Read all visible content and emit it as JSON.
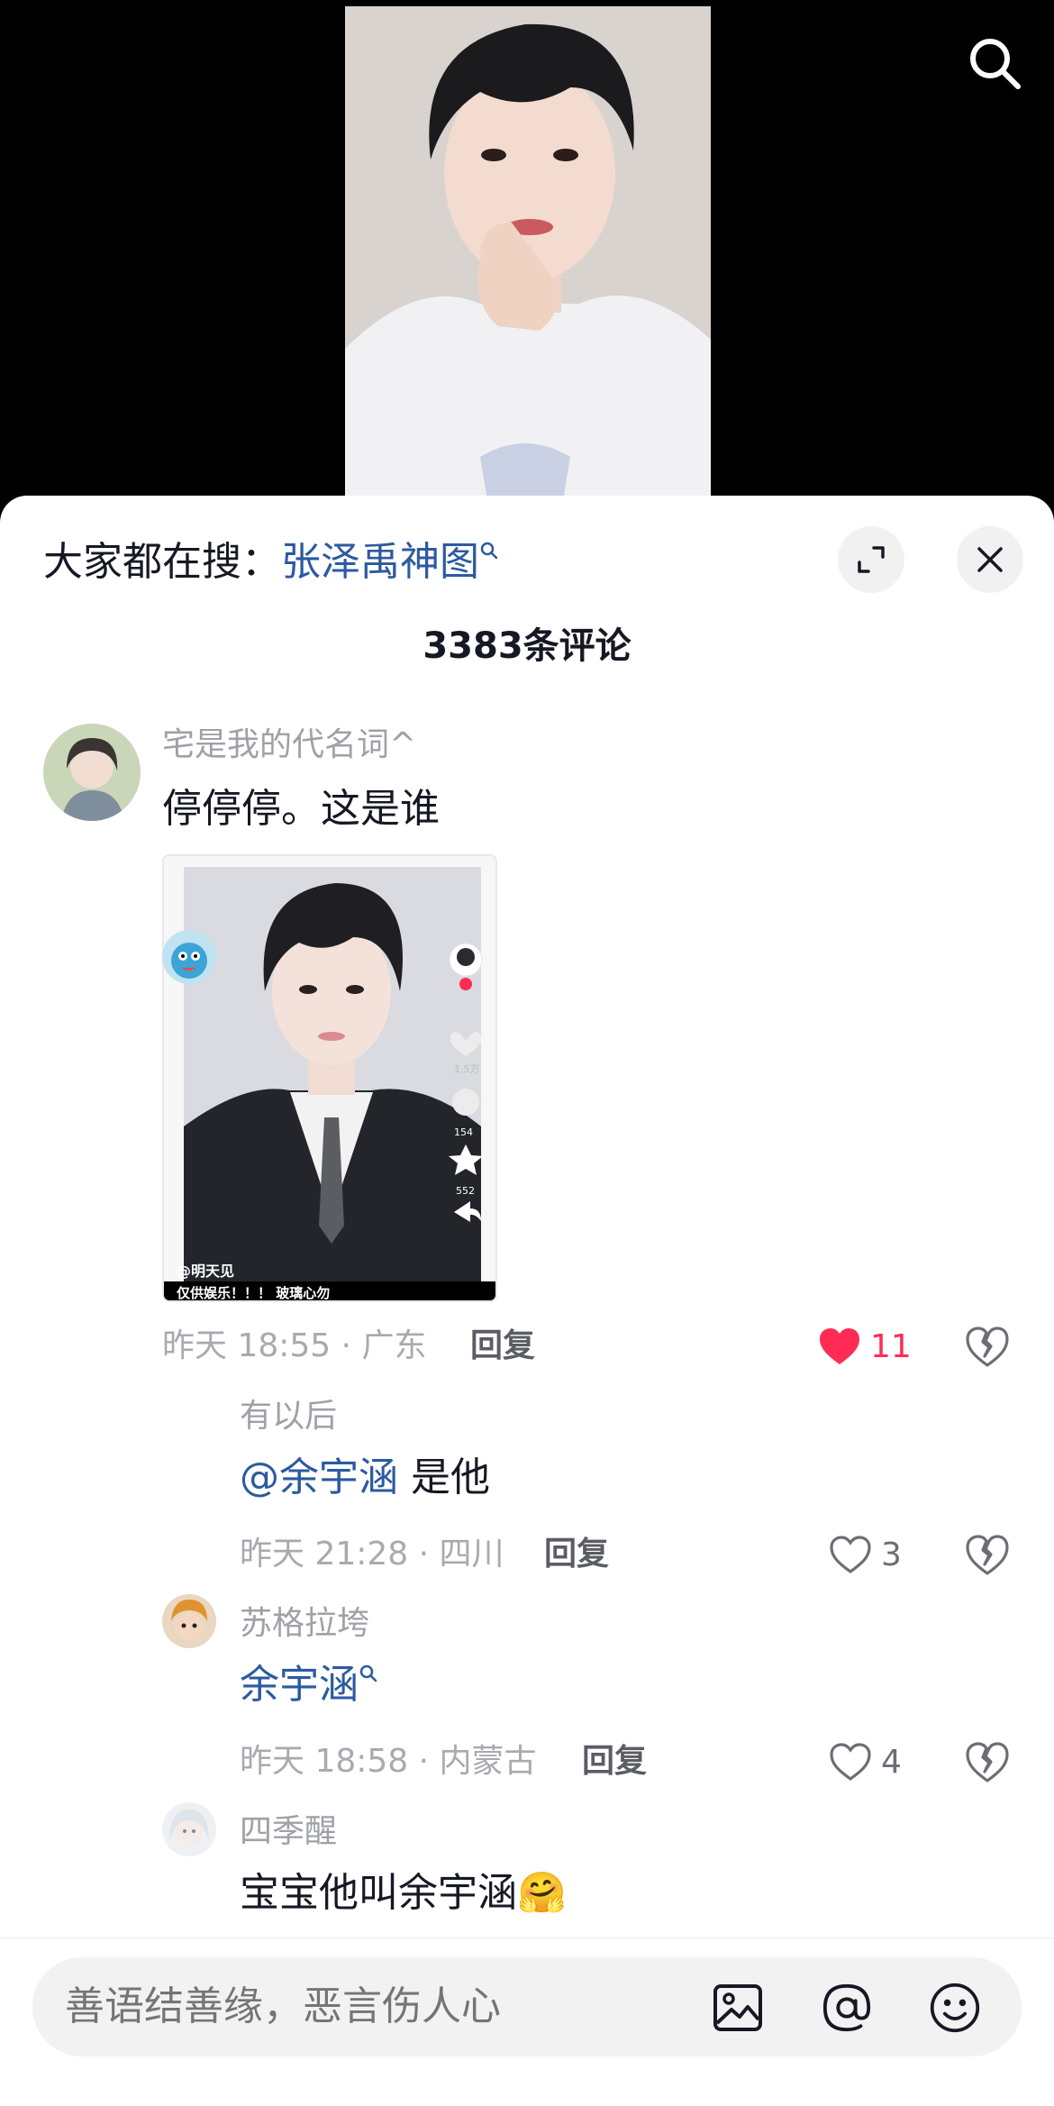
{
  "trend": {
    "prefix": "大家都在搜：",
    "keyword": "张泽禹神图"
  },
  "comments_count": "3383条评论",
  "main_comment": {
    "username": "宅是我的代名词^",
    "text": "停停停。这是谁",
    "image_caption": "@明天见",
    "image_banner": "仅供娱乐！！！ 玻璃心勿",
    "image_side_counts": [
      "1.5万",
      "154",
      "552"
    ],
    "time": "昨天 18:55 · 广东",
    "reply_label": "回复",
    "likes": "11",
    "liked": true
  },
  "replies": [
    {
      "username": "有以后",
      "mention": "@余宇涵",
      "text": " 是他",
      "time": "昨天 21:28 · 四川",
      "reply_label": "回复",
      "likes": "3"
    },
    {
      "username": "苏格拉垮",
      "keyword": "余宇涵",
      "time": "昨天 18:58 · 内蒙古",
      "reply_label": "回复",
      "likes": "4"
    },
    {
      "username": "四季醒",
      "text": "宝宝他叫余宇涵",
      "emoji": "🤗"
    }
  ],
  "input": {
    "placeholder": "善语结善缘，恶言伤人心"
  },
  "colors": {
    "accent_link": "#2c5aa0",
    "like_red": "#fe2c55",
    "meta_gray": "#a8aab0"
  },
  "icons": [
    "search-icon",
    "expand-icon",
    "close-icon",
    "heart-icon",
    "dislike-icon",
    "image-icon",
    "at-icon",
    "emoji-icon"
  ]
}
